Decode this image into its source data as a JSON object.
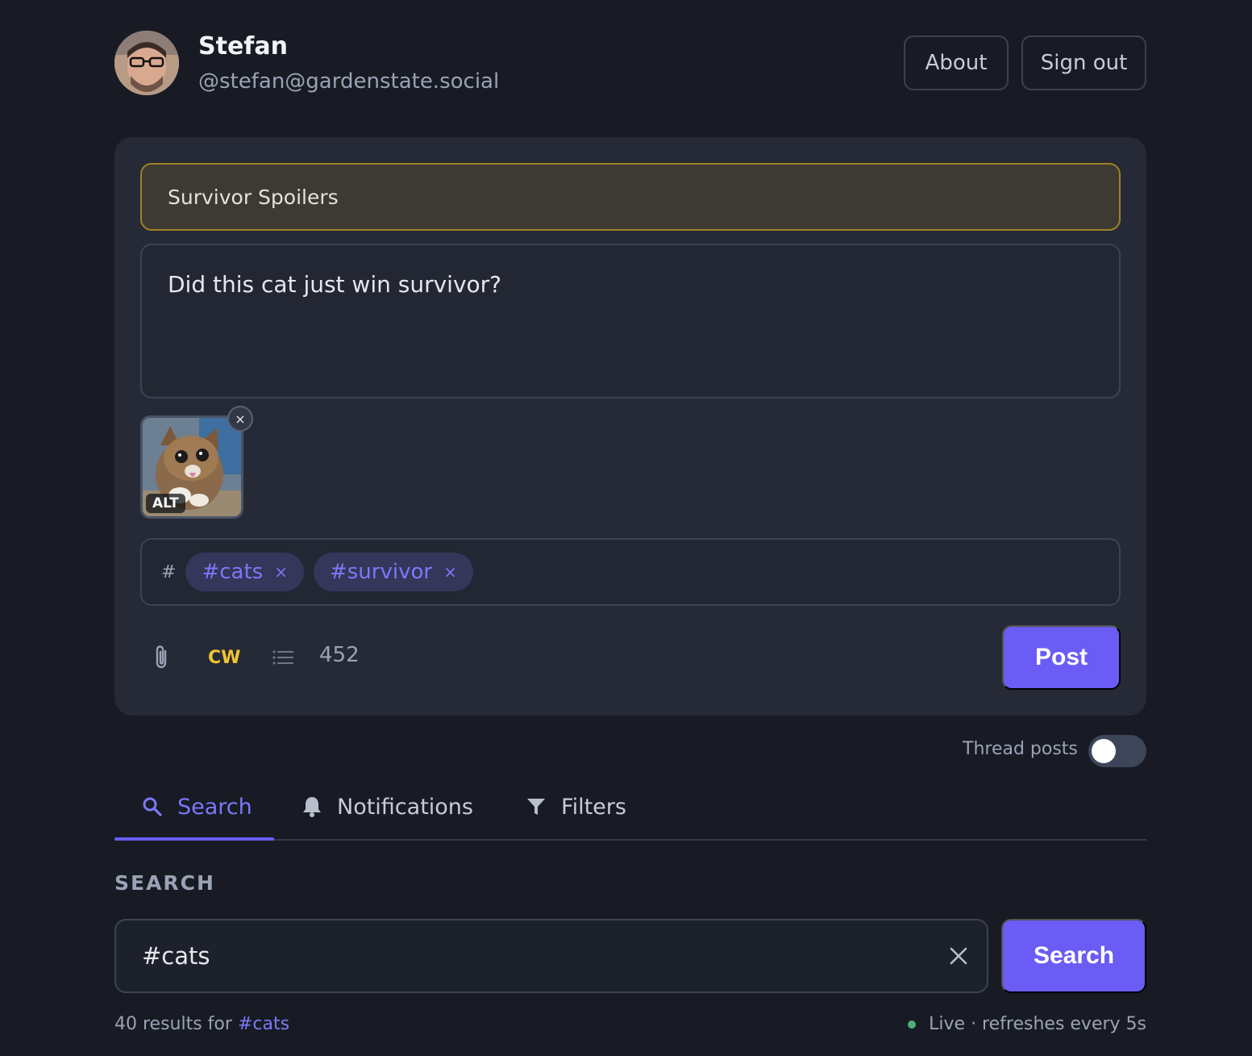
{
  "profile": {
    "name": "Stefan",
    "handle": "@stefan@gardenstate.social"
  },
  "header": {
    "about_label": "About",
    "signout_label": "Sign out"
  },
  "composer": {
    "content_warning": "Survivor Spoilers",
    "text": "Did this cat just win survivor?",
    "attachment": {
      "alt_badge": "ALT",
      "remove_symbol": "×"
    },
    "tags_prefix": "#",
    "tags": [
      "#cats",
      "#survivor"
    ],
    "tag_remove_symbol": "×",
    "cw_label": "CW",
    "char_count": "452",
    "post_label": "Post",
    "colors": {
      "accent": "#6a5cf5",
      "cw_yellow": "#f0c431",
      "cw_border": "#a08126"
    }
  },
  "thread": {
    "label": "Thread posts",
    "enabled": false
  },
  "tabs": [
    {
      "label": "Search",
      "icon": "search-icon",
      "active": true
    },
    {
      "label": "Notifications",
      "icon": "bell-icon",
      "active": false
    },
    {
      "label": "Filters",
      "icon": "filter-icon",
      "active": false
    }
  ],
  "search": {
    "section_title": "SEARCH",
    "query": "#cats",
    "button_label": "Search",
    "results_prefix": "40 results for ",
    "results_term": "#cats",
    "live_text": "Live · refreshes every 5s"
  }
}
